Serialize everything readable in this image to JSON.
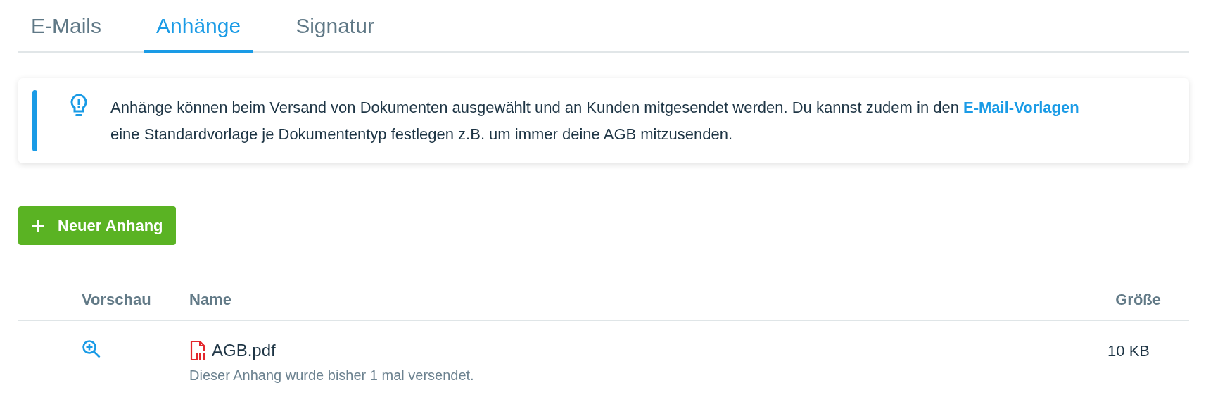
{
  "tabs": [
    {
      "label": "E-Mails",
      "selected": false
    },
    {
      "label": "Anhänge",
      "selected": true
    },
    {
      "label": "Signatur",
      "selected": false
    }
  ],
  "info": {
    "text_before": "Anhänge können beim Versand von Dokumenten ausgewählt und an Kunden mitgesendet werden. Du kannst zudem in den ",
    "link": "E-Mail-Vorlagen",
    "text_after": " eine Standardvorlage je Dokumententyp festlegen z.B. um immer deine AGB mitzusenden."
  },
  "new_button": {
    "label": "Neuer Anhang"
  },
  "table": {
    "columns": [
      "Vorschau",
      "Name",
      "Größe"
    ],
    "rows": [
      {
        "name": "AGB.pdf",
        "note": "Dieser Anhang wurde bisher 1 mal versendet.",
        "size": "10 KB"
      }
    ]
  }
}
